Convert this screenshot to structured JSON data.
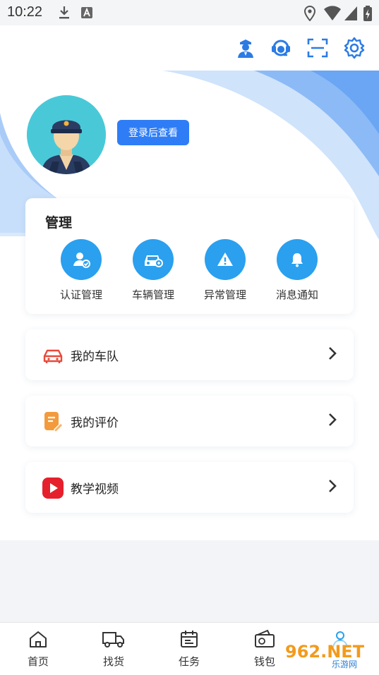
{
  "status_bar": {
    "time": "10:22"
  },
  "profile": {
    "login_button": "登录后查看"
  },
  "management": {
    "title": "管理",
    "items": [
      {
        "label": "认证管理"
      },
      {
        "label": "车辆管理"
      },
      {
        "label": "异常管理"
      },
      {
        "label": "消息通知"
      }
    ]
  },
  "menu": [
    {
      "label": "我的车队"
    },
    {
      "label": "我的评价"
    },
    {
      "label": "教学视频"
    }
  ],
  "bottom_nav": [
    {
      "label": "首页"
    },
    {
      "label": "找货"
    },
    {
      "label": "任务"
    },
    {
      "label": "钱包"
    }
  ],
  "watermark": {
    "text": "962.NET",
    "subtext": "乐游网"
  },
  "colors": {
    "accent": "#2f7df6",
    "icon_blue": "#2aa0ef",
    "wave_light": "#cfe3fb",
    "wave_mid": "#8cbaf6"
  }
}
